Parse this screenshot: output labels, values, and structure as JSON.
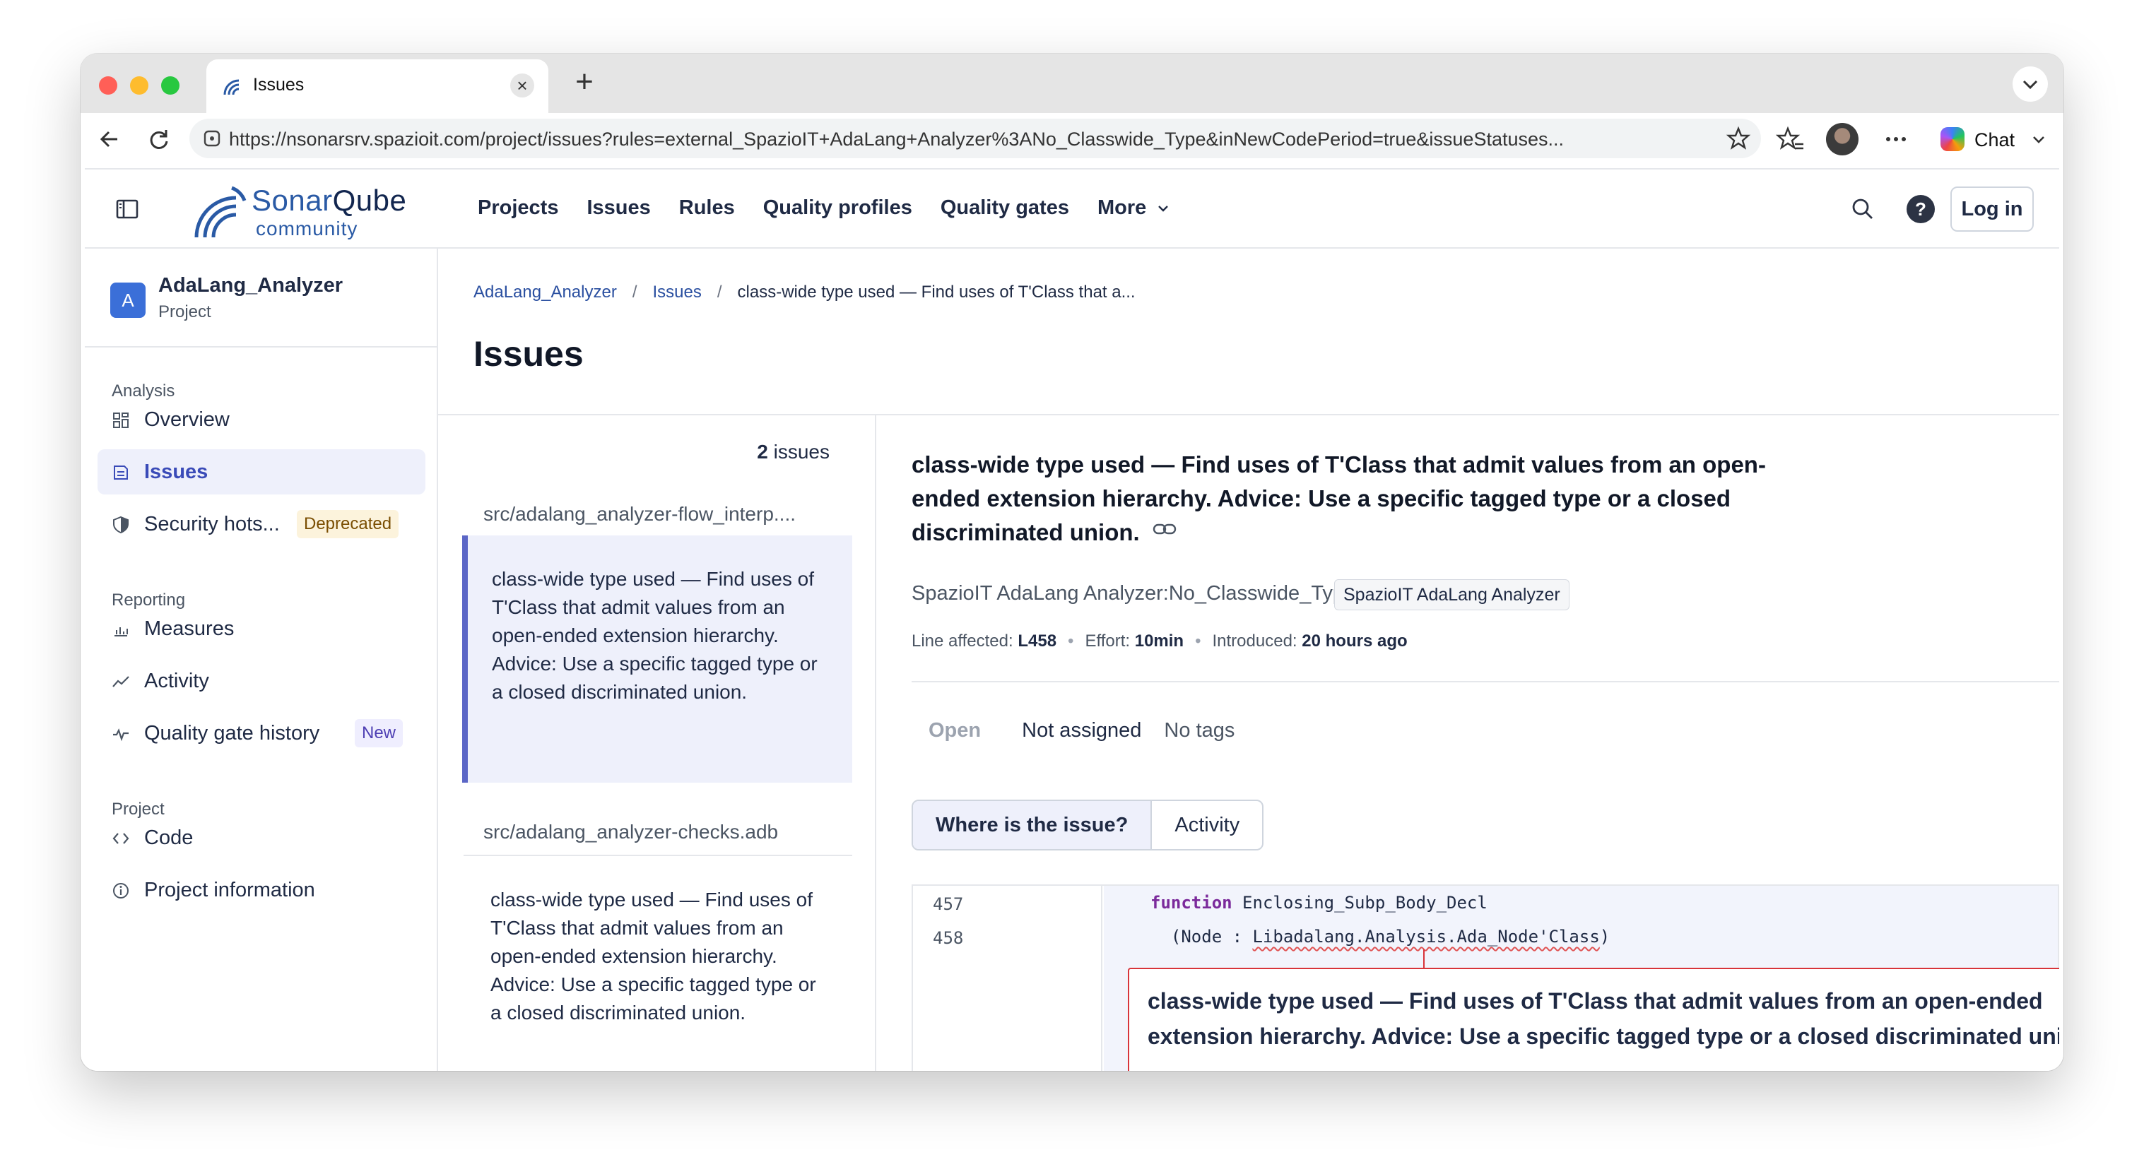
{
  "browser": {
    "tab_title": "Issues",
    "url": "https://nsonarsrv.spazioit.com/project/issues?rules=external_SpazioIT+AdaLang+Analyzer%3ANo_Classwide_Type&inNewCodePeriod=true&issueStatuses...",
    "chat_label": "Chat"
  },
  "header": {
    "logo_name_light": "Sonar",
    "logo_name_dark": "Qube",
    "logo_edition": "community",
    "nav": [
      "Projects",
      "Issues",
      "Rules",
      "Quality profiles",
      "Quality gates"
    ],
    "more_label": "More",
    "login_label": "Log in",
    "help_glyph": "?"
  },
  "sidebar": {
    "project_initial": "A",
    "project_name": "AdaLang_Analyzer",
    "project_kind": "Project",
    "sections": {
      "analysis": "Analysis",
      "reporting": "Reporting",
      "project": "Project"
    },
    "items": {
      "overview": "Overview",
      "issues": "Issues",
      "security": "Security hots...",
      "security_badge": "Deprecated",
      "measures": "Measures",
      "activity": "Activity",
      "qg_history": "Quality gate history",
      "qg_badge": "New",
      "code": "Code",
      "info": "Project information"
    }
  },
  "content": {
    "breadcrumb": {
      "project": "AdaLang_Analyzer",
      "issues": "Issues",
      "current": "class-wide type used — Find uses of T'Class that a..."
    },
    "title": "Issues",
    "issue_count": "2",
    "issue_count_label": "issues",
    "files": [
      {
        "path": "src/adalang_analyzer-flow_interp....",
        "message": "class-wide type used — Find uses of T'Class that admit values from an open-ended extension hierarchy. Advice: Use a specific tagged type or a closed discriminated union."
      },
      {
        "path": "src/adalang_analyzer-checks.adb",
        "message": "class-wide type used — Find uses of T'Class that admit values from an open-ended extension hierarchy. Advice: Use a specific tagged type or a closed discriminated union."
      }
    ]
  },
  "details": {
    "title": "class-wide type used — Find uses of T'Class that admit values from an open-ended extension hierarchy. Advice: Use a specific tagged type or a closed discriminated union.",
    "rule_key": "SpazioIT AdaLang Analyzer:No_Classwide_Type",
    "rule_tag": "SpazioIT AdaLang Analyzer",
    "line_label": "Line affected:",
    "line_value": "L458",
    "effort_label": "Effort:",
    "effort_value": "10min",
    "introduced_label": "Introduced:",
    "introduced_value": "20 hours ago",
    "status": "Open",
    "assignee": "Not assigned",
    "tags": "No tags",
    "tab_where": "Where is the issue?",
    "tab_activity": "Activity",
    "code": {
      "line_457": "457",
      "line_458": "458",
      "kw_function": "function",
      "fn_name": " Enclosing_Subp_Body_Decl",
      "param_prefix": "  (Node : ",
      "param_type": "Libadalang.Analysis.Ada_Node'Class",
      "param_suffix": ")"
    },
    "popup": "class-wide type used — Find uses of T'Class that admit values from an open-ended extension hierarchy. Advice: Use a specific tagged type or a closed discriminated union."
  }
}
